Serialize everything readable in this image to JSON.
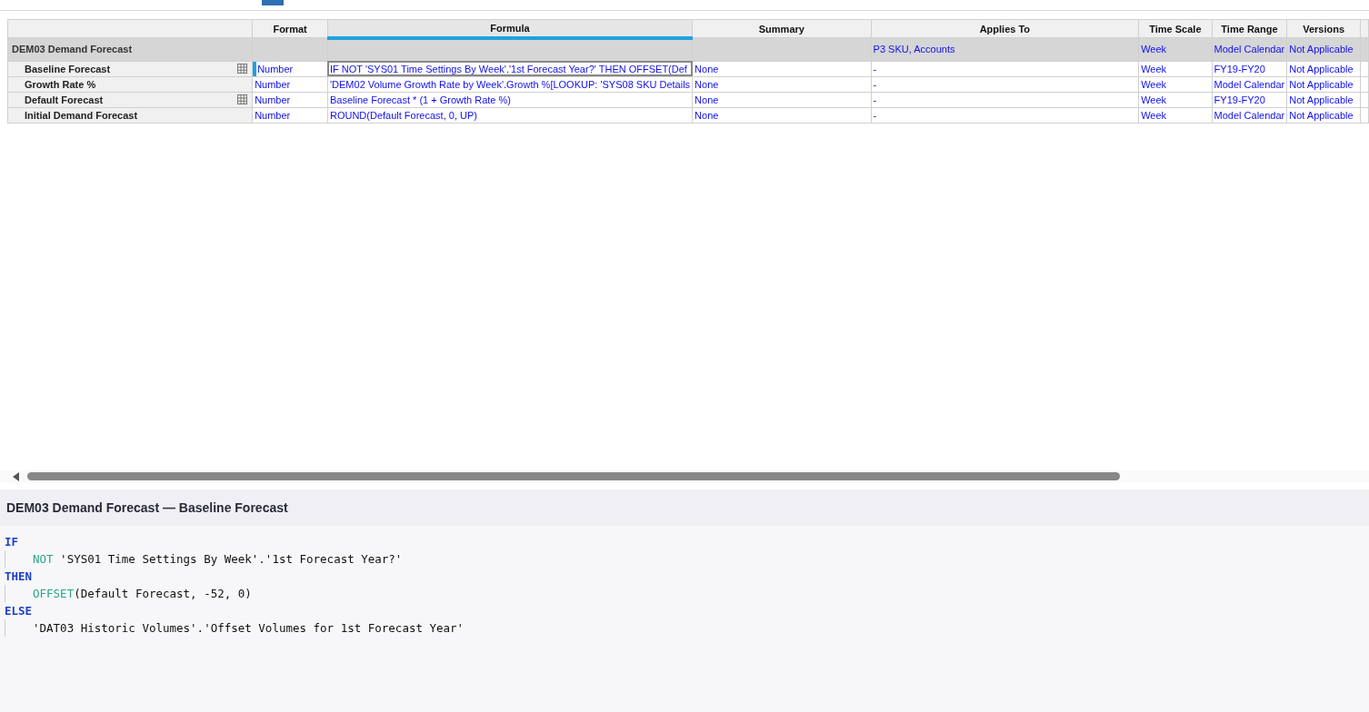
{
  "columns": [
    {
      "label": "Format",
      "selected": false
    },
    {
      "label": "Formula",
      "selected": true
    },
    {
      "label": "Summary",
      "selected": false
    },
    {
      "label": "Applies To",
      "selected": false
    },
    {
      "label": "Time Scale",
      "selected": false
    },
    {
      "label": "Time Range",
      "selected": false
    },
    {
      "label": "Versions",
      "selected": false
    }
  ],
  "group": {
    "name": "DEM03 Demand Forecast",
    "cells": [
      null,
      null,
      null,
      "P3 SKU, Accounts",
      "Week",
      "Model Calendar",
      "Not Applicable"
    ]
  },
  "rows": [
    {
      "name": "Baseline Forecast",
      "grid_icon": true,
      "selected": true,
      "cells": [
        "Number",
        "IF NOT 'SYS01 Time Settings By Week'.'1st Forecast Year?' THEN OFFSET(Def",
        "None",
        "-",
        "Week",
        "FY19-FY20",
        "Not Applicable"
      ]
    },
    {
      "name": "Growth Rate %",
      "grid_icon": false,
      "selected": false,
      "cells": [
        "Number",
        "'DEM02 Volume Growth Rate by Week'.Growth %[LOOKUP: 'SYS08 SKU Details",
        "None",
        "-",
        "Week",
        "Model Calendar",
        "Not Applicable"
      ]
    },
    {
      "name": "Default Forecast",
      "grid_icon": true,
      "selected": false,
      "cells": [
        "Number",
        "Baseline Forecast * (1 + Growth Rate %)",
        "None",
        "-",
        "Week",
        "FY19-FY20",
        "Not Applicable"
      ]
    },
    {
      "name": "Initial Demand Forecast",
      "grid_icon": false,
      "selected": false,
      "cells": [
        "Number",
        "ROUND(Default Forecast, 0, UP)",
        "None",
        "-",
        "Week",
        "Model Calendar",
        "Not Applicable"
      ]
    }
  ],
  "editor": {
    "title": "DEM03 Demand Forecast — Baseline Forecast",
    "lines": [
      {
        "indent": false,
        "tokens": [
          {
            "kind": "keyword",
            "text": "IF"
          }
        ]
      },
      {
        "indent": true,
        "tokens": [
          {
            "kind": "function",
            "text": "NOT"
          },
          {
            "kind": "plain",
            "text": " 'SYS01 Time Settings By Week'.'1st Forecast Year?'"
          }
        ]
      },
      {
        "indent": false,
        "tokens": [
          {
            "kind": "keyword",
            "text": "THEN"
          }
        ]
      },
      {
        "indent": true,
        "tokens": [
          {
            "kind": "function",
            "text": "OFFSET"
          },
          {
            "kind": "plain",
            "text": "(Default Forecast, -52, 0)"
          }
        ]
      },
      {
        "indent": false,
        "tokens": [
          {
            "kind": "keyword",
            "text": "ELSE"
          }
        ]
      },
      {
        "indent": true,
        "tokens": [
          {
            "kind": "plain",
            "text": "'DAT03 Historic Volumes'.'Offset Volumes for 1st Forecast Year'"
          }
        ]
      }
    ]
  }
}
